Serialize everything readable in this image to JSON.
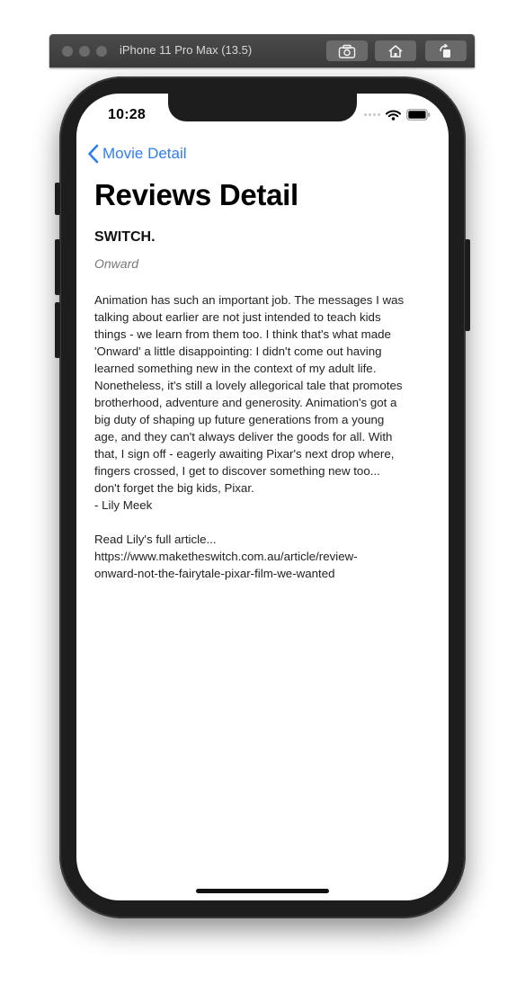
{
  "simulator": {
    "title": "iPhone 11 Pro Max (13.5)",
    "buttons": [
      "screenshot-icon",
      "home-icon",
      "rotate-icon"
    ]
  },
  "status_bar": {
    "time": "10:28"
  },
  "nav": {
    "back_label": "Movie Detail"
  },
  "page": {
    "title": "Reviews Detail"
  },
  "review": {
    "author": "SWITCH.",
    "movie": "Onward",
    "lines": [
      "Animation has such an important job. The messages I was",
      "talking about earlier are not just intended to teach kids",
      "things - we learn from them too. I think that's what made",
      "'Onward' a little disappointing: I didn't come out having",
      "learned something new in the context of my adult life.",
      "Nonetheless, it's still a lovely allegorical tale that promotes",
      "brotherhood, adventure and generosity. Animation's got a",
      "big duty of shaping up future generations from a young",
      "age, and they can't always deliver the goods for all. With",
      "that, I sign off - eagerly awaiting Pixar's next drop where,",
      "fingers crossed, I get to discover something new too...",
      "don't forget the big kids, Pixar.",
      "- Lily Meek",
      "",
      "Read Lily's full article...",
      "https://www.maketheswitch.com.au/article/review-",
      "onward-not-the-fairytale-pixar-film-we-wanted"
    ]
  },
  "colors": {
    "accent": "#2f7cf6",
    "device": "#1d1d1d",
    "simulator_bar": "#3f3f3f"
  }
}
